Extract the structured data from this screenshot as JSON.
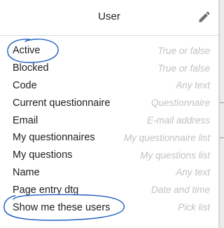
{
  "header": {
    "title": "User"
  },
  "fields": [
    {
      "label": "Active",
      "type": "True or false"
    },
    {
      "label": "Blocked",
      "type": "True or false"
    },
    {
      "label": "Code",
      "type": "Any text"
    },
    {
      "label": "Current questionnaire",
      "type": "Questionnaire"
    },
    {
      "label": "Email",
      "type": "E-mail address"
    },
    {
      "label": "My questionnaires",
      "type": "My questionnaire list"
    },
    {
      "label": "My questions",
      "type": "My questions list"
    },
    {
      "label": "Name",
      "type": "Any text"
    },
    {
      "label": "Page entry dtg",
      "type": "Date and time"
    },
    {
      "label": "Show me these users",
      "type": "Pick list"
    }
  ],
  "annotation_color": "#1f5fbf",
  "icons": {
    "edit": "pencil-icon"
  }
}
